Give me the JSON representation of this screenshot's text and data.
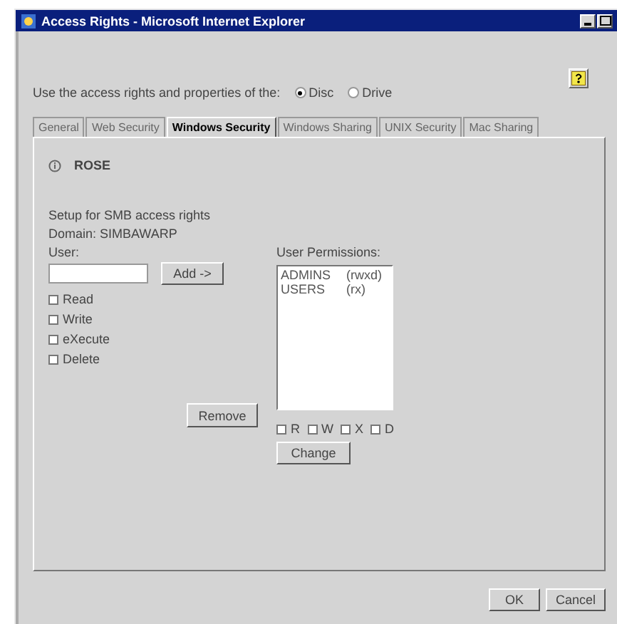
{
  "window": {
    "title": "Access Rights - Microsoft Internet Explorer"
  },
  "source": {
    "label": "Use the access rights and properties of the:",
    "options": [
      {
        "label": "Disc",
        "selected": true
      },
      {
        "label": "Drive",
        "selected": false
      }
    ]
  },
  "tabs": [
    {
      "label": "General",
      "selected": false
    },
    {
      "label": "Web Security",
      "selected": false
    },
    {
      "label": "Windows Security",
      "selected": true
    },
    {
      "label": "Windows Sharing",
      "selected": false
    },
    {
      "label": "UNIX Security",
      "selected": false
    },
    {
      "label": "Mac Sharing",
      "selected": false
    }
  ],
  "object_name": "ROSE",
  "setup_text": "Setup for SMB access rights",
  "domain_text": "Domain: SIMBAWARP",
  "user": {
    "label": "User:",
    "add_button": "Add ->",
    "rights": [
      {
        "label": "Read",
        "checked": false
      },
      {
        "label": "Write",
        "checked": false
      },
      {
        "label": "eXecute",
        "checked": false
      },
      {
        "label": "Delete",
        "checked": false
      }
    ],
    "remove_button": "Remove"
  },
  "permissions": {
    "label": "User Permissions:",
    "items": [
      {
        "name": "ADMINS",
        "rights": "(rwxd)",
        "selected": false
      },
      {
        "name": "USERS",
        "rights": "(rx)",
        "selected": false
      }
    ],
    "flags": [
      {
        "label": "R",
        "checked": false
      },
      {
        "label": "W",
        "checked": false
      },
      {
        "label": "X",
        "checked": false
      },
      {
        "label": "D",
        "checked": false
      }
    ],
    "change_button": "Change"
  },
  "buttons": [
    "OK",
    "Cancel"
  ]
}
